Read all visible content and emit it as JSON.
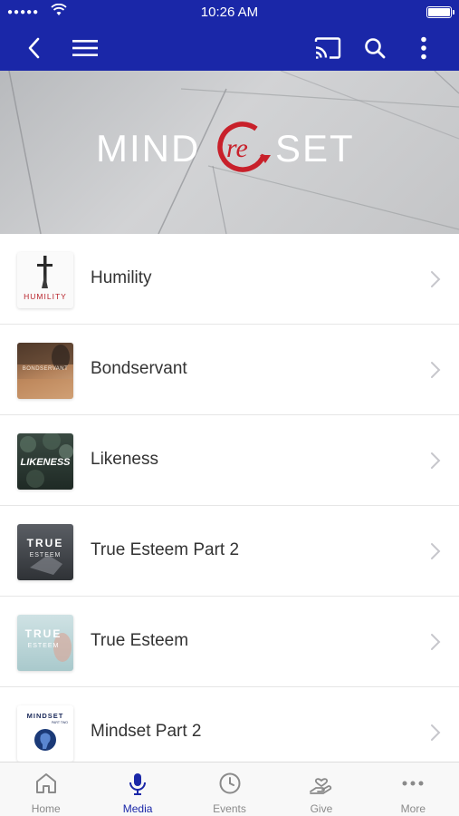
{
  "status_bar": {
    "time": "10:26 AM",
    "signal": "●●●●●"
  },
  "app_bar": {
    "back_icon": "chevron-left-icon",
    "menu_icon": "hamburger-icon",
    "cast_icon": "cast-icon",
    "search_icon": "search-icon",
    "more_icon": "more-vertical-icon"
  },
  "banner": {
    "logo_left": "MIND",
    "logo_mid": "re",
    "logo_right": "SET",
    "accent": "#c8202a"
  },
  "thumbs": {
    "humility": "HUMILITY",
    "bondservant": "BONDSERVANT",
    "likeness": "LIKENESS",
    "true_esteem_2": [
      "TRUE",
      "ESTEEM"
    ],
    "true_esteem": [
      "TRUE",
      "ESTEEM"
    ],
    "mindset": "MINDSET",
    "mindset_sub": "PART TWO"
  },
  "list": [
    {
      "title": "Humility"
    },
    {
      "title": "Bondservant"
    },
    {
      "title": "Likeness"
    },
    {
      "title": "True Esteem Part 2"
    },
    {
      "title": "True Esteem"
    },
    {
      "title": "Mindset Part 2"
    }
  ],
  "tabs": [
    {
      "label": "Home",
      "icon": "home-icon",
      "active": false
    },
    {
      "label": "Media",
      "icon": "microphone-icon",
      "active": true
    },
    {
      "label": "Events",
      "icon": "clock-icon",
      "active": false
    },
    {
      "label": "Give",
      "icon": "give-hand-icon",
      "active": false
    },
    {
      "label": "More",
      "icon": "more-horizontal-icon",
      "active": false
    }
  ],
  "colors": {
    "brand": "#1a27a8",
    "tab_inactive": "#8a8a8a",
    "chevron": "#c7c7cc"
  }
}
